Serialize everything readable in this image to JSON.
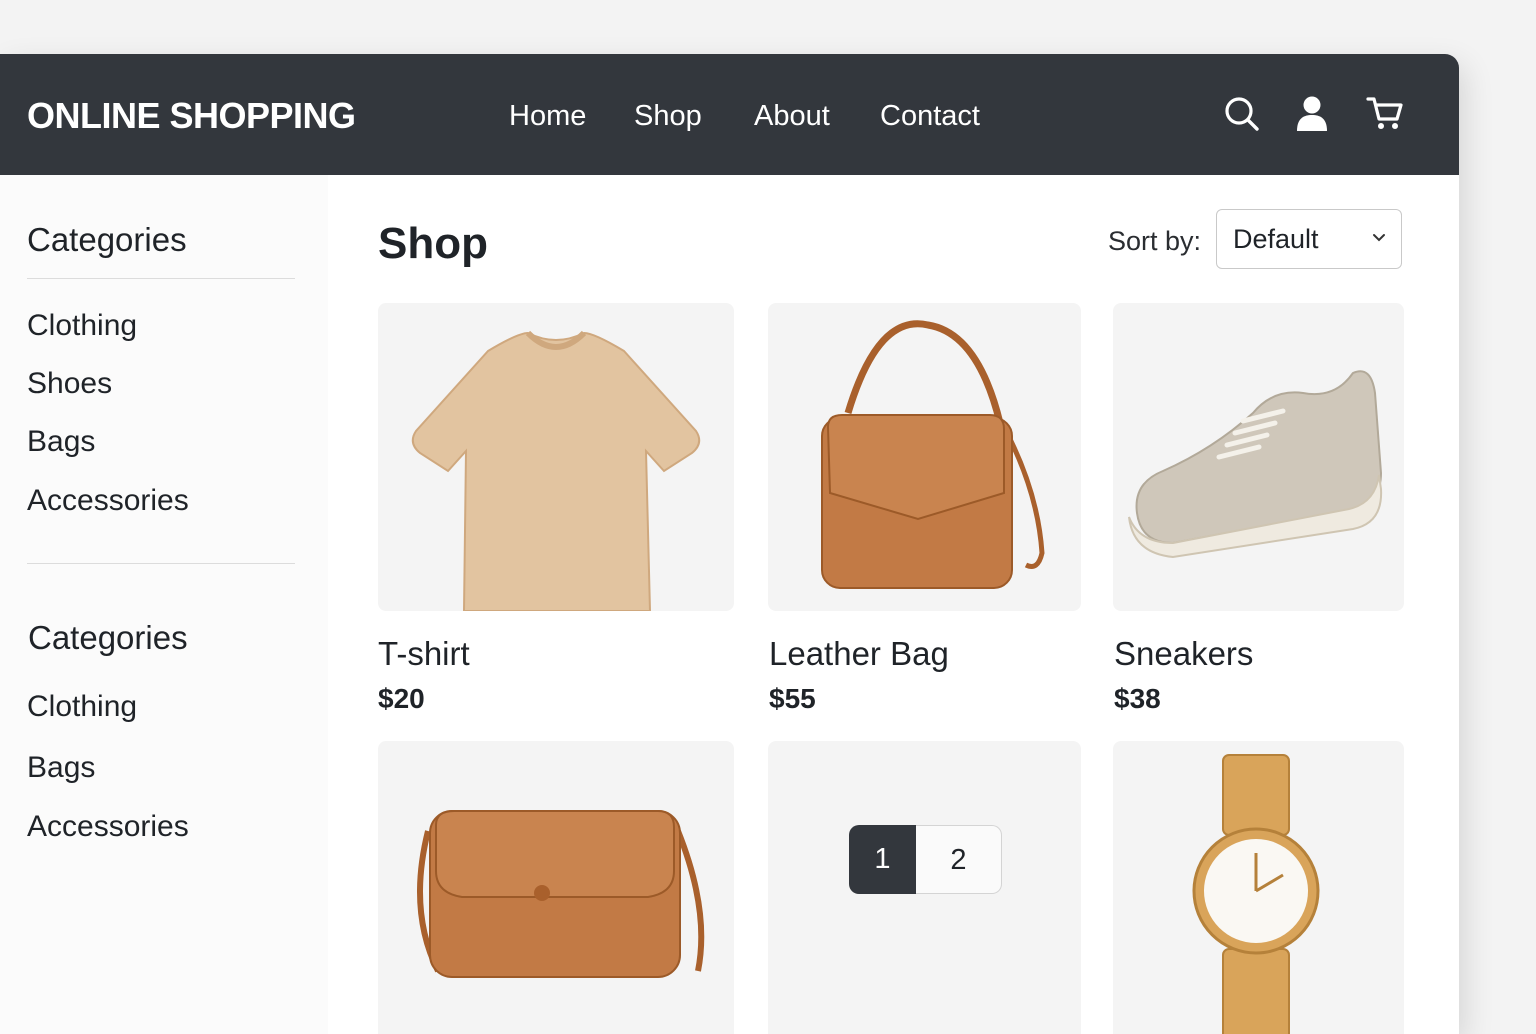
{
  "navbar": {
    "brand": "ONLINE SHOPPING",
    "links": [
      "Home",
      "Shop",
      "About",
      "Contact"
    ],
    "icons": [
      "search-icon",
      "user-icon",
      "cart-icon"
    ]
  },
  "sidebar": {
    "sections": [
      {
        "title": "Categories",
        "items": [
          "Clothing",
          "Shoes",
          "Bags",
          "Accessories"
        ]
      },
      {
        "title": "Categories",
        "items": [
          "Clothing",
          "Bags",
          "Accessories"
        ]
      }
    ]
  },
  "main": {
    "title": "Shop",
    "sort": {
      "label": "Sort by:",
      "value": "Default"
    },
    "products": [
      {
        "name": "T-shirt",
        "price": "$20",
        "image": "tshirt-image"
      },
      {
        "name": "Leather Bag",
        "price": "$55",
        "image": "handbag-image"
      },
      {
        "name": "Sneakers",
        "price": "$38",
        "image": "sneaker-image"
      },
      {
        "image": "crossbody-bag-image"
      },
      {
        "image": "watch-image"
      }
    ],
    "pagination": {
      "pages": [
        "1",
        "2"
      ],
      "current": "1"
    }
  },
  "colors": {
    "navbar": "#33373d",
    "leather": "#c27a45",
    "tshirt": "#e2c4a0",
    "sneaker": "#cfc7ba",
    "gold": "#d9a45a"
  }
}
